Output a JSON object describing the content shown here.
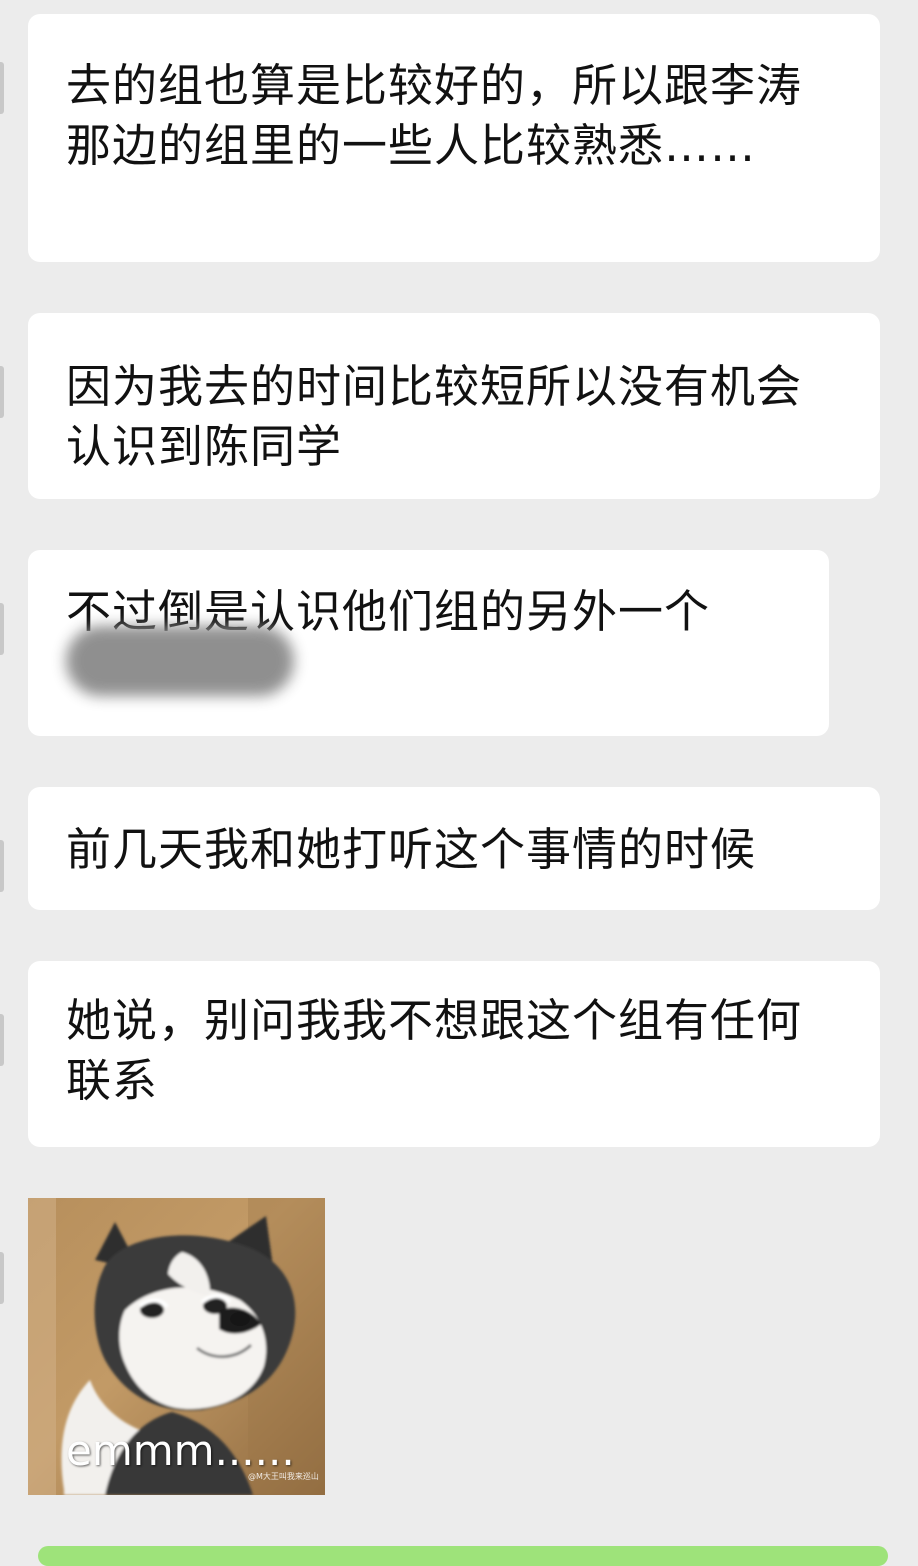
{
  "messages": [
    {
      "text": "去的组也算是比较好的，所以跟李涛那边的组里的一些人比较熟悉……"
    },
    {
      "text": "因为我去的时间比较短所以没有机会认识到陈同学"
    },
    {
      "text": "不过倒是认识他们组的另外一个"
    },
    {
      "text": "前几天我和她打听这个事情的时候"
    },
    {
      "text": "她说，别问我我不想跟这个组有任何联系"
    }
  ],
  "sticker": {
    "caption": "emmm......",
    "watermark": "@M大王叫我来巡山"
  },
  "colors": {
    "background": "#ececec",
    "bubble": "#ffffff",
    "text": "#111111",
    "sent_bubble_accent": "#9ee37a"
  }
}
